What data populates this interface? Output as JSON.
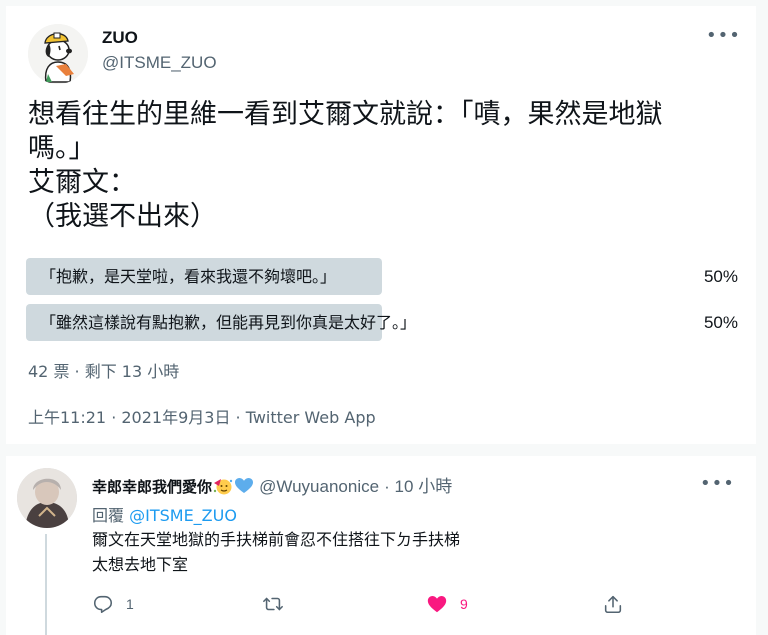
{
  "tweet": {
    "display_name": "ZUO",
    "handle": "@ITSME_ZUO",
    "more_icon": "more-icon",
    "text": "想看往生的里維一看到艾爾文就說：「嘖，果然是地獄\n嗎。」\n艾爾文：\n（我選不出來）",
    "poll": {
      "options": [
        {
          "label": "「抱歉，是天堂啦，看來我還不夠壞吧。」",
          "percent": "50%",
          "fraction": 0.5
        },
        {
          "label": "「雖然這樣說有點抱歉，但能再見到你真是太好了。」",
          "percent": "50%",
          "fraction": 0.5
        }
      ],
      "meta": "42 票 · 剩下 13 小時",
      "bar_color": "#cfd9de"
    },
    "timestamp": "上午11:21 · 2021年9月3日 · Twitter Web App"
  },
  "reply": {
    "display_name": "幸郎幸郎我們愛你",
    "name_emojis": [
      "party-face-icon",
      "blue-heart-icon"
    ],
    "handle": "@Wuyuanonice",
    "time": "· 10 小時",
    "replying_label": "回覆",
    "replying_to": "@ITSME_ZUO",
    "text": "爾文在天堂地獄的手扶梯前會忍不住搭往下ㄉ手扶梯\n太想去地下室",
    "actions": {
      "reply_count": "1",
      "retweet_count": "",
      "like_count": "9",
      "share_count": ""
    }
  },
  "colors": {
    "text_primary": "#0f1419",
    "text_secondary": "#536471",
    "link": "#1d9bf0",
    "like": "#f91880",
    "background": "#f7f9f9"
  }
}
